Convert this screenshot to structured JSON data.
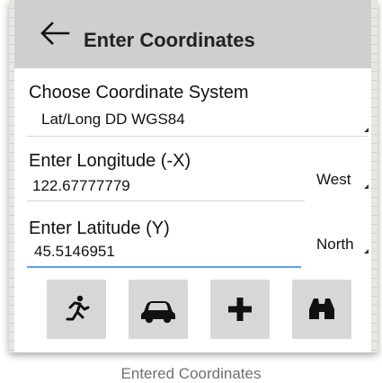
{
  "header": {
    "title": "Enter Coordinates",
    "back_icon": "arrow-left-icon"
  },
  "coordinate_system": {
    "label": "Choose Coordinate System",
    "value": "Lat/Long DD WGS84"
  },
  "longitude": {
    "label": "Enter Longitude (-X)",
    "value": "122.67777779",
    "hemisphere": "West"
  },
  "latitude": {
    "label": "Enter Latitude (Y)",
    "value": "45.5146951",
    "hemisphere": "North"
  },
  "actions": [
    {
      "icon": "walking-person-icon"
    },
    {
      "icon": "car-icon"
    },
    {
      "icon": "plus-icon"
    },
    {
      "icon": "binoculars-icon"
    }
  ],
  "caption": "Entered Coordinates",
  "colors": {
    "titlebar": "#cfcfcf",
    "button": "#d7d7d7",
    "active_underline": "#5aa0e6"
  }
}
